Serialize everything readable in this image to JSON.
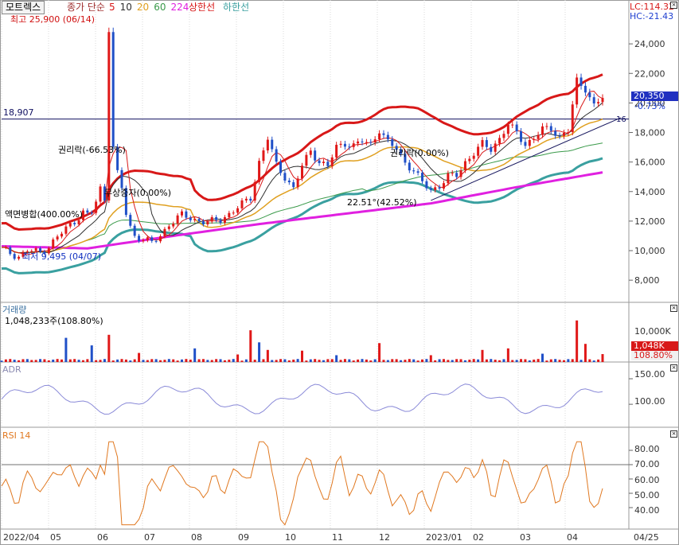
{
  "header": {
    "stock_name": "모트렉스",
    "ma_prefix": "종가 단순",
    "ma_periods": [
      {
        "label": "5",
        "color": "#d81818"
      },
      {
        "label": "10",
        "color": "#303030"
      },
      {
        "label": "20",
        "color": "#e0a020"
      },
      {
        "label": "60",
        "color": "#3a9a4a"
      },
      {
        "label": "224",
        "color": "#e020e0"
      }
    ],
    "upper_limit_label": "상한선",
    "lower_limit_label": "하한선",
    "upper_limit_color": "#d81818",
    "lower_limit_color": "#3aa0a0",
    "lc_value": "LC:114.32",
    "hc_value": "HC:-21.43"
  },
  "price_panel": {
    "y_ticks": [
      "24,000",
      "22,000",
      "20,000",
      "18,000",
      "16,000",
      "14,000",
      "12,000",
      "10,000",
      "8,000"
    ],
    "y_range": [
      6500,
      26000
    ],
    "current_price": "20,350",
    "current_change": "-0.73%",
    "hline_value": "18,907",
    "hline_right_label": "16",
    "high_label": "최고 25,900 (06/14)",
    "low_label": "최저 9,495 (04/07)",
    "annotations": {
      "rights": "권리락(-66.53%)",
      "split": "액면병합(400.00%)",
      "capital_increase": "권리락(0.00%)",
      "bonus_issue": "무상증자(0.00%)",
      "trendline": "22.51°(42.52%)"
    }
  },
  "volume_panel": {
    "title": "거래량",
    "value_text": "1,048,233주(108.80%)",
    "y_tick": "10,000K",
    "tag_value": "1,048K",
    "tag_pct": "108.80%"
  },
  "adr_panel": {
    "title": "ADR",
    "y_ticks": [
      "150.00",
      "100.00"
    ],
    "y_range": [
      55,
      175
    ]
  },
  "rsi_panel": {
    "title": "RSI 14",
    "y_ticks": [
      "80.00",
      "70.00",
      "60.00",
      "50.00",
      "40.00"
    ],
    "y_range": [
      25,
      90
    ],
    "overbought": 70
  },
  "x_axis": {
    "labels": [
      "2022/04",
      "05",
      "06",
      "07",
      "08",
      "09",
      "10",
      "11",
      "12",
      "2023/01",
      "02",
      "03",
      "04"
    ],
    "right_label": "04/25"
  },
  "chart_data": {
    "type": "line",
    "title": "모트렉스",
    "months": [
      "2022/04",
      "05",
      "06",
      "07",
      "08",
      "09",
      "10",
      "11",
      "12",
      "2023/01",
      "02",
      "03",
      "04"
    ],
    "price_path": [
      [
        0,
        10100
      ],
      [
        4,
        9600
      ],
      [
        6,
        10000
      ],
      [
        9,
        9900
      ],
      [
        11,
        10300
      ],
      [
        13,
        10900
      ],
      [
        15,
        11500
      ],
      [
        17,
        12000
      ],
      [
        19,
        12600
      ],
      [
        20,
        12400
      ],
      [
        21,
        12600
      ],
      [
        22,
        13300
      ],
      [
        23,
        14200
      ],
      [
        24,
        13500
      ],
      [
        25,
        24800
      ],
      [
        26,
        17000
      ],
      [
        27,
        15200
      ],
      [
        28,
        14200
      ],
      [
        29,
        12500
      ],
      [
        30,
        11600
      ],
      [
        31,
        11000
      ],
      [
        33,
        10800
      ],
      [
        35,
        10500
      ],
      [
        37,
        11000
      ],
      [
        39,
        11800
      ],
      [
        42,
        12400
      ],
      [
        45,
        12100
      ],
      [
        48,
        11900
      ],
      [
        51,
        12100
      ],
      [
        55,
        12900
      ],
      [
        58,
        13600
      ],
      [
        60,
        16000
      ],
      [
        62,
        17600
      ],
      [
        64,
        15800
      ],
      [
        66,
        15000
      ],
      [
        68,
        14200
      ],
      [
        70,
        15700
      ],
      [
        72,
        16800
      ],
      [
        74,
        16000
      ],
      [
        76,
        15700
      ],
      [
        78,
        17000
      ],
      [
        80,
        17300
      ],
      [
        82,
        17100
      ],
      [
        84,
        17400
      ],
      [
        86,
        17200
      ],
      [
        88,
        18200
      ],
      [
        90,
        17300
      ],
      [
        92,
        16900
      ],
      [
        94,
        16000
      ],
      [
        96,
        15400
      ],
      [
        98,
        14600
      ],
      [
        100,
        14100
      ],
      [
        102,
        14400
      ],
      [
        104,
        15000
      ],
      [
        106,
        15100
      ],
      [
        108,
        16000
      ],
      [
        110,
        16600
      ],
      [
        112,
        17200
      ],
      [
        114,
        16900
      ],
      [
        116,
        17600
      ],
      [
        118,
        18500
      ],
      [
        120,
        18000
      ],
      [
        122,
        17200
      ],
      [
        124,
        17600
      ],
      [
        126,
        18200
      ],
      [
        128,
        18300
      ],
      [
        130,
        17700
      ],
      [
        132,
        18100
      ],
      [
        134,
        21500
      ],
      [
        136,
        21000
      ],
      [
        138,
        19800
      ],
      [
        140,
        20350
      ]
    ],
    "ma224_path": [
      [
        0,
        10300
      ],
      [
        20,
        10150
      ],
      [
        40,
        11000
      ],
      [
        60,
        11800
      ],
      [
        80,
        12500
      ],
      [
        100,
        13200
      ],
      [
        120,
        14300
      ],
      [
        140,
        15300
      ]
    ],
    "volume_peaks_k": [
      [
        15,
        3200
      ],
      [
        21,
        2200
      ],
      [
        25,
        3600
      ],
      [
        32,
        1200
      ],
      [
        45,
        1800
      ],
      [
        55,
        1000
      ],
      [
        58,
        4200
      ],
      [
        60,
        2600
      ],
      [
        62,
        1600
      ],
      [
        70,
        1500
      ],
      [
        78,
        900
      ],
      [
        88,
        2500
      ],
      [
        100,
        900
      ],
      [
        112,
        1600
      ],
      [
        118,
        1800
      ],
      [
        126,
        1100
      ],
      [
        134,
        5500
      ],
      [
        136,
        2400
      ],
      [
        140,
        1048
      ]
    ]
  }
}
